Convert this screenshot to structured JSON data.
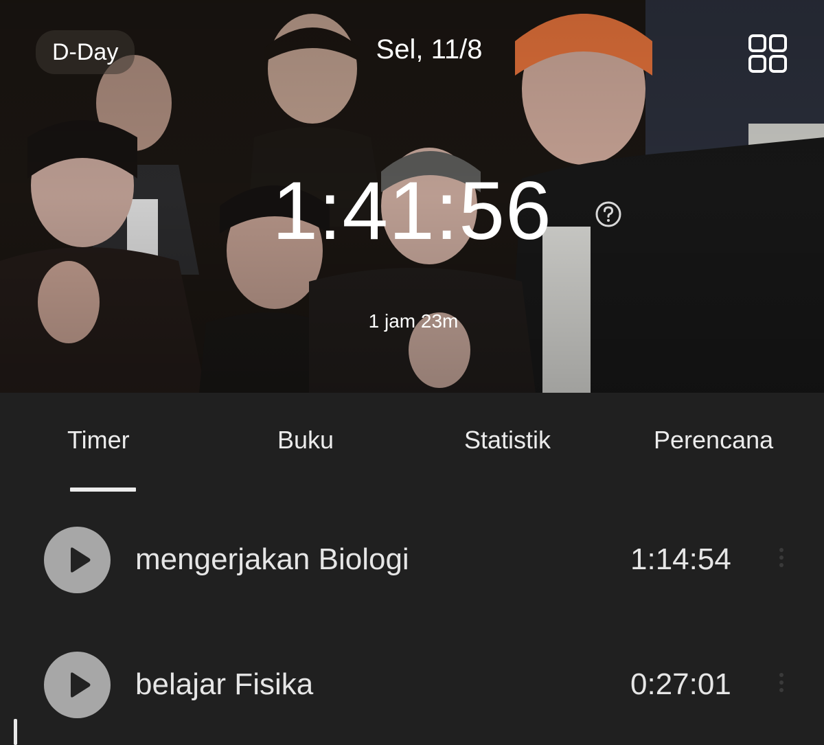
{
  "header": {
    "dday_label": "D-Day",
    "date_label": "Sel, 11/8",
    "total_time": "1:41:56",
    "sub_time": "1 jam 23m",
    "grid_icon": "grid-icon",
    "help_icon": "help-circle-icon"
  },
  "tabs": [
    {
      "label": "Timer",
      "active": true
    },
    {
      "label": "Buku",
      "active": false
    },
    {
      "label": "Statistik",
      "active": false
    },
    {
      "label": "Perencana",
      "active": false
    }
  ],
  "tasks": [
    {
      "name": "mengerjakan Biologi",
      "time": "1:14:54",
      "icon": "play-icon",
      "menu_icon": "more-vertical-icon"
    },
    {
      "name": "belajar Fisika",
      "time": "0:27:01",
      "icon": "play-icon",
      "menu_icon": "more-vertical-icon"
    }
  ],
  "colors": {
    "background": "#202020",
    "play_button": "#a7a7a7",
    "text": "#e6e6e6",
    "accent": "#ffffff"
  }
}
